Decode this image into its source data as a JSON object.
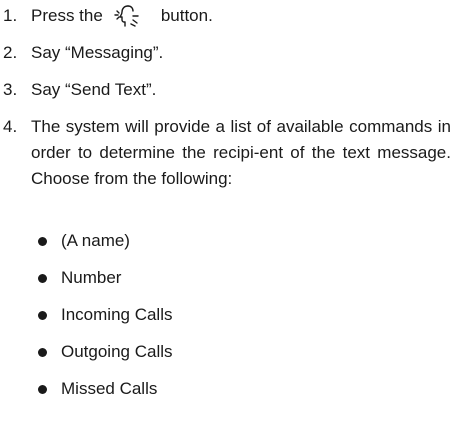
{
  "steps": [
    {
      "number": "1.",
      "before_icon": "Press the",
      "icon": "talk-voice-icon",
      "after_icon": "button."
    },
    {
      "number": "2.",
      "text": "Say “Messaging”."
    },
    {
      "number": "3.",
      "text": "Say “Send Text”."
    },
    {
      "number": "4.",
      "text": "The system will provide a list of available commands in order to determine the recipi-ent of the text message. Choose from the following:"
    }
  ],
  "options": [
    "(A name)",
    "Number",
    "Incoming Calls",
    "Outgoing Calls",
    "Missed Calls"
  ]
}
